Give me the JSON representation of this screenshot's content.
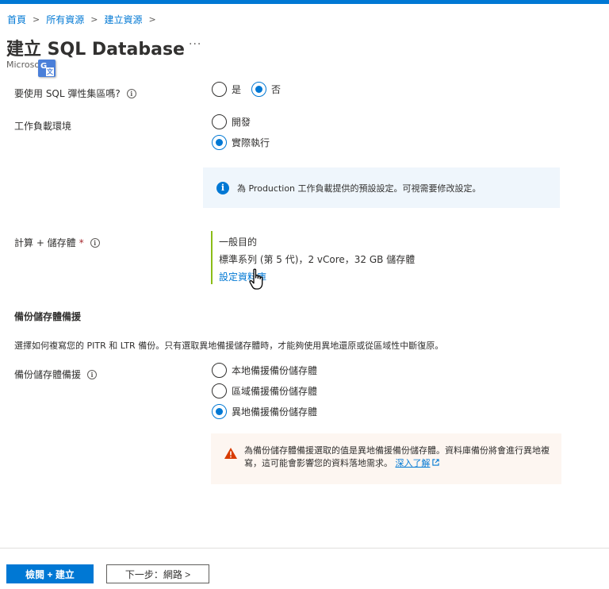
{
  "breadcrumb": {
    "items": [
      "首頁",
      "所有資源",
      "建立資源"
    ],
    "separator": ">"
  },
  "header": {
    "title": "建立 SQL Database",
    "more": "···",
    "subtitle": "Microsoft"
  },
  "elastic_pool": {
    "label": "要使用 SQL 彈性集區嗎?",
    "options": [
      "是",
      "否"
    ],
    "selected": "否"
  },
  "workload": {
    "label": "工作負載環境",
    "options": [
      "開發",
      "實際執行"
    ],
    "selected": "實際執行",
    "info_message": "為 Production 工作負載提供的預設設定。可視需要修改設定。"
  },
  "compute": {
    "label": "計算 + 儲存體",
    "required_mark": "*",
    "tier": "一般目的",
    "details": "標準系列 (第 5 代)，2 vCore，32 GB 儲存體",
    "configure_link": "設定資料庫"
  },
  "backup": {
    "section_title": "備份儲存體備援",
    "description": "選擇如何複寫您的 PITR 和 LTR 備份。只有選取異地備援儲存體時，才能夠使用異地還原或從區域性中斷復原。",
    "label": "備份儲存體備援",
    "options": [
      "本地備援備份儲存體",
      "區域備援備份儲存體",
      "異地備援備份儲存體"
    ],
    "selected": "異地備援備份儲存體",
    "warning_text": "為備份儲存體備援選取的值是異地備援備份儲存體。資料庫備份將會進行異地複寫，這可能會影響您的資料落地需求。",
    "warning_link": "深入了解"
  },
  "footer": {
    "review_button": "檢閱 + 建立",
    "next_button": "下一步：網路 >"
  },
  "colors": {
    "accent": "#0078d4",
    "compute_bar": "#8cbd18",
    "info_bg": "#eff6fc",
    "warning_bg": "#fdf6f1",
    "warning_icon": "#d83b01"
  }
}
